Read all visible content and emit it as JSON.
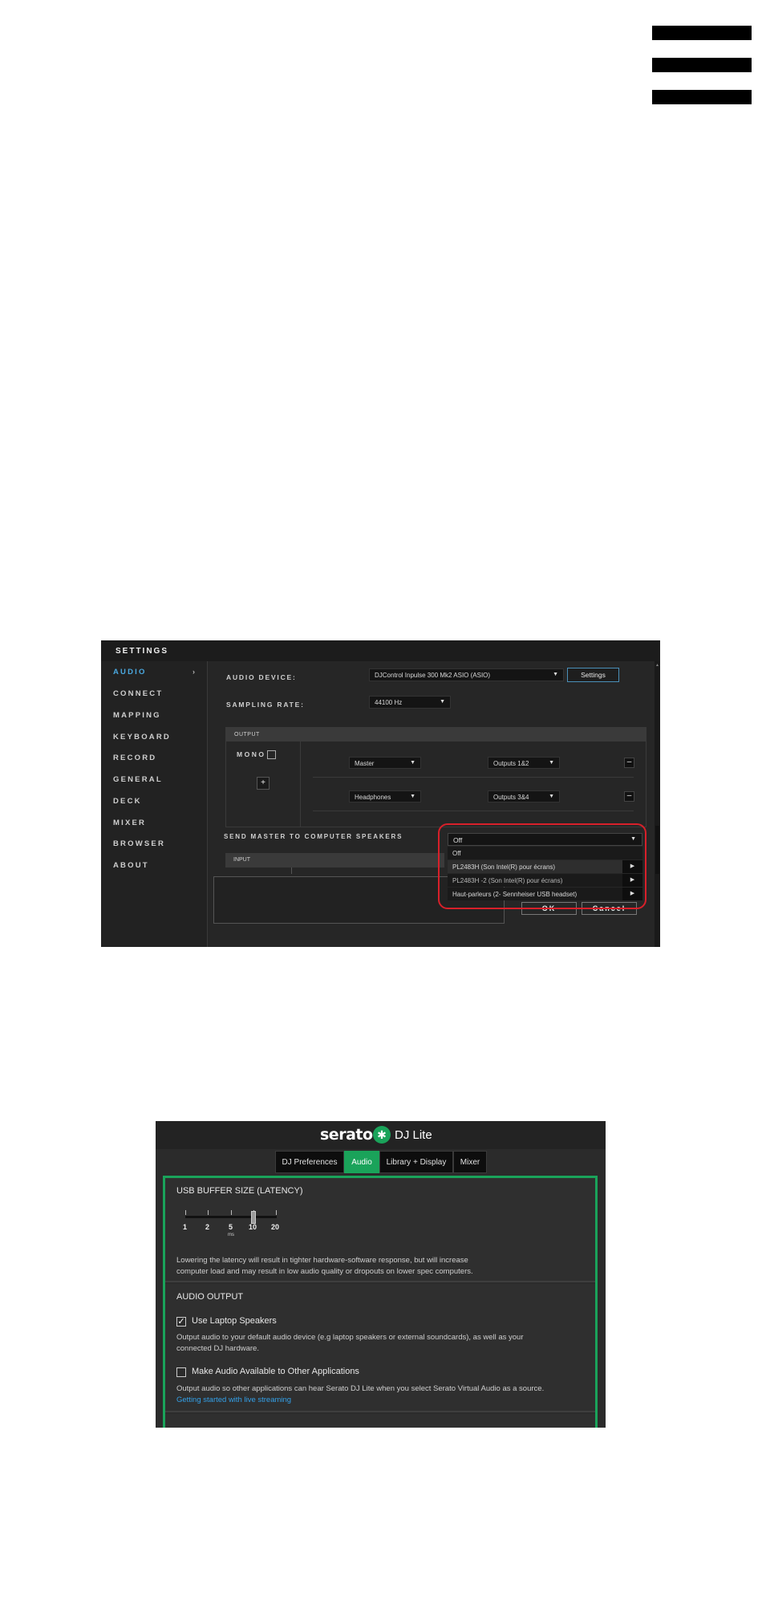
{
  "hamburger": {
    "icon": "hamburger-menu-icon"
  },
  "settings": {
    "title": "SETTINGS",
    "nav": [
      {
        "label": "AUDIO",
        "active": true
      },
      {
        "label": "CONNECT"
      },
      {
        "label": "MAPPING"
      },
      {
        "label": "KEYBOARD"
      },
      {
        "label": "RECORD"
      },
      {
        "label": "GENERAL"
      },
      {
        "label": "DECK"
      },
      {
        "label": "MIXER"
      },
      {
        "label": "BROWSER"
      },
      {
        "label": "ABOUT"
      }
    ],
    "nav_arrow": "›",
    "audio_device_label": "AUDIO DEVICE:",
    "audio_device_value": "DJControl Inpulse 300 Mk2 ASIO (ASIO)",
    "settings_button": "Settings",
    "sampling_rate_label": "SAMPLING RATE:",
    "sampling_rate_value": "44100 Hz",
    "output_header": "OUTPUT",
    "mono_label": "MONO",
    "add_button": "+",
    "rows": [
      {
        "channel": "Master",
        "outputs": "Outputs 1&2"
      },
      {
        "channel": "Headphones",
        "outputs": "Outputs 3&4"
      }
    ],
    "remove_button": "–",
    "send_master_label": "SEND MASTER TO COMPUTER SPEAKERS",
    "input_header": "INPUT",
    "send_master_selected": "Off",
    "send_master_options": [
      "Off",
      "PL2483H (Son Intel(R) pour écrans)",
      "PL2483H -2 (Son Intel(R) pour écrans)",
      "Haut-parleurs (2- Sennheiser USB headset)"
    ],
    "ok_button": "OK",
    "cancel_button": "Cancel",
    "caret": "▼",
    "submenu_arrow": "▶"
  },
  "serato": {
    "brand": "serato",
    "product": "DJ Lite",
    "tabs": [
      "DJ Preferences",
      "Audio",
      "Library + Display",
      "Mixer"
    ],
    "active_tab": "Audio",
    "usb_buffer_title": "USB BUFFER SIZE (LATENCY)",
    "slider_ticks": [
      "1",
      "2",
      "5",
      "10",
      "20"
    ],
    "slider_unit": "ms",
    "slider_value": 10,
    "latency_desc_1": "Lowering the latency will result in tighter hardware-software response, but will increase",
    "latency_desc_2": "computer load and may result in low audio quality or dropouts on lower spec computers.",
    "audio_output_title": "AUDIO OUTPUT",
    "use_laptop_speakers": "Use Laptop Speakers",
    "use_laptop_speakers_checked": true,
    "laptop_desc_1": "Output audio to your default audio device (e.g laptop speakers or external soundcards), as well as your",
    "laptop_desc_2": "connected DJ hardware.",
    "make_audio_available": "Make Audio Available to Other Applications",
    "make_audio_available_checked": false,
    "other_apps_desc": "Output audio so other applications can hear Serato DJ Lite when you select Serato Virtual Audio as a source.",
    "live_streaming_link": "Getting started with live streaming",
    "check_mark": "✓"
  },
  "colors": {
    "serato_green": "#1aa35a",
    "audio_active_blue": "#4aa8e0",
    "highlight_red": "#d8202a",
    "link_blue": "#33a0e8"
  }
}
